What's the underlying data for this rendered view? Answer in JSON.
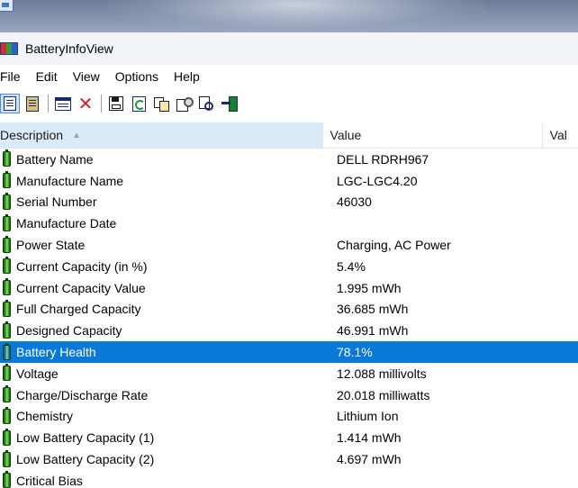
{
  "window": {
    "title": "BatteryInfoView"
  },
  "menu": [
    "File",
    "Edit",
    "View",
    "Options",
    "Help"
  ],
  "toolbar": [
    {
      "name": "html-report-all-button",
      "icon": "document-icon"
    },
    {
      "name": "html-report-selected-button",
      "icon": "document-list-icon"
    },
    {
      "name": "options-button",
      "icon": "window-icon"
    },
    {
      "name": "delete-button",
      "icon": "close-x-icon"
    },
    {
      "name": "save-button",
      "icon": "save-icon"
    },
    {
      "name": "refresh-button",
      "icon": "refresh-icon"
    },
    {
      "name": "copy-button",
      "icon": "copy-icon"
    },
    {
      "name": "properties-button",
      "icon": "properties-icon"
    },
    {
      "name": "find-button",
      "icon": "find-icon"
    },
    {
      "name": "exit-button",
      "icon": "exit-icon"
    }
  ],
  "columns": {
    "description": "Description",
    "value": "Value",
    "value2": "Val"
  },
  "rows": [
    {
      "description": "Battery Name",
      "value": "DELL RDRH967"
    },
    {
      "description": "Manufacture Name",
      "value": "LGC-LGC4.20"
    },
    {
      "description": "Serial Number",
      "value": "46030"
    },
    {
      "description": "Manufacture Date",
      "value": ""
    },
    {
      "description": "Power State",
      "value": "Charging, AC Power"
    },
    {
      "description": "Current Capacity (in %)",
      "value": "5.4%"
    },
    {
      "description": "Current Capacity Value",
      "value": "1.995 mWh"
    },
    {
      "description": "Full Charged Capacity",
      "value": "36.685 mWh"
    },
    {
      "description": "Designed Capacity",
      "value": "46.991 mWh"
    },
    {
      "description": "Battery Health",
      "value": "78.1%"
    },
    {
      "description": "Voltage",
      "value": "12.088 millivolts"
    },
    {
      "description": "Charge/Discharge Rate",
      "value": "20.018 milliwatts"
    },
    {
      "description": "Chemistry",
      "value": "Lithium Ion"
    },
    {
      "description": "Low Battery Capacity (1)",
      "value": "1.414 mWh"
    },
    {
      "description": "Low Battery Capacity (2)",
      "value": "4.697 mWh"
    },
    {
      "description": "Critical Bias",
      "value": ""
    }
  ],
  "selected_row": "Battery Health",
  "colors": {
    "selection": "#0a78d7",
    "header_sorted": "#d9ebf9"
  }
}
